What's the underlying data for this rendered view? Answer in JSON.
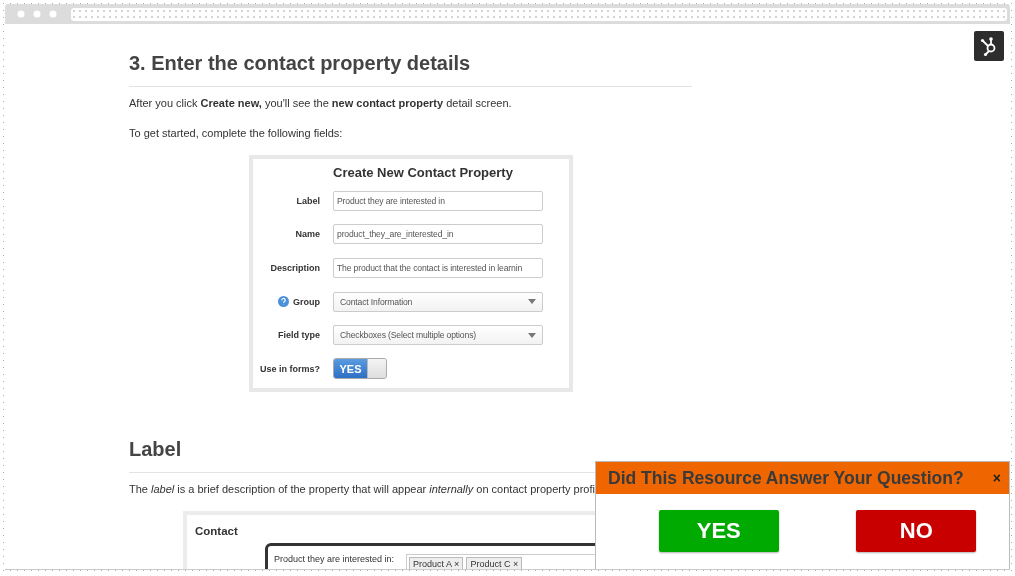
{
  "heading": "3. Enter the contact property details",
  "intro": "After you click **Create new,** you'll see the **new contact property** detail screen.",
  "instruction": "To get started, complete the following fields:",
  "form": {
    "title": "Create New Contact Property",
    "fields": [
      {
        "kind": "text",
        "label": "Label",
        "value": "Product they are interested in",
        "help": false
      },
      {
        "kind": "text",
        "label": "Name",
        "value": "product_they_are_interested_in",
        "help": false
      },
      {
        "kind": "text",
        "label": "Description",
        "value": "The product that the contact is interested in learnin",
        "help": false
      },
      {
        "kind": "select",
        "label": "Group",
        "value": "Contact Information",
        "help": true
      },
      {
        "kind": "select",
        "label": "Field type",
        "value": "Checkboxes (Select multiple options)",
        "help": false
      },
      {
        "kind": "toggle",
        "label": "Use in forms?",
        "value": "YES",
        "on": true,
        "help": false
      }
    ]
  },
  "section": {
    "heading": "Label",
    "text": "The *label* is a brief description of the property that will appear *internally* on contact property profi",
    "example": {
      "title": "Contact",
      "field_label": "Product they are interested in:",
      "tags": [
        "Product A ×",
        "Product C ×"
      ]
    }
  },
  "feedback": {
    "question": "Did This Resource Answer Your Question?",
    "close": "×",
    "buttons": [
      {
        "kind": "yes",
        "label": "YES"
      },
      {
        "kind": "no",
        "label": "NO"
      }
    ]
  }
}
